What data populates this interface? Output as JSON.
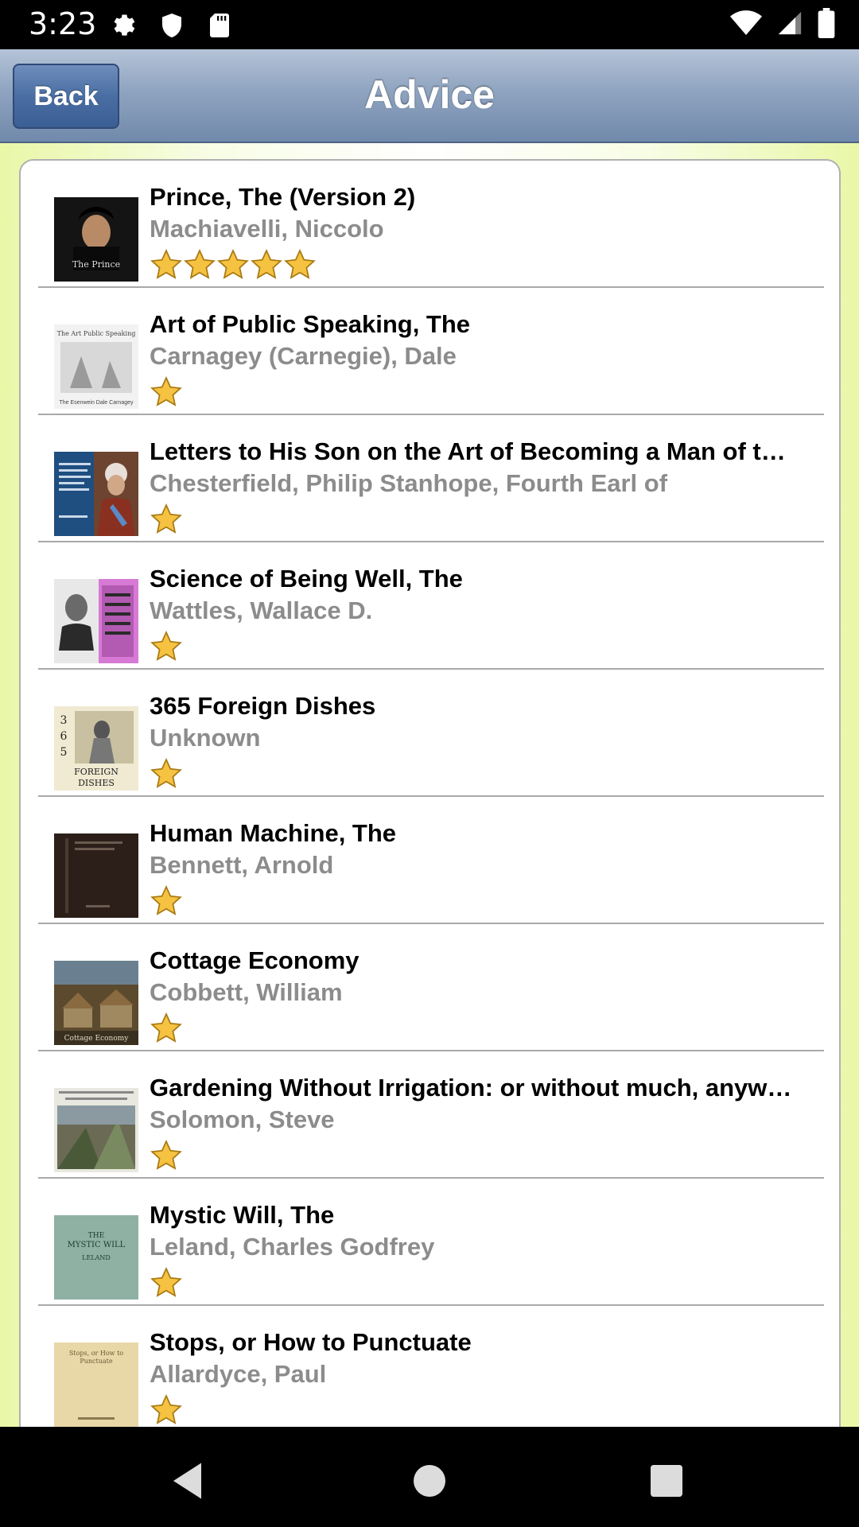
{
  "status_bar": {
    "time": "3:23",
    "icons": [
      "gear-icon",
      "shield-icon",
      "sd-card-icon",
      "wifi-icon",
      "signal-icon",
      "battery-icon"
    ]
  },
  "header": {
    "back_label": "Back",
    "title": "Advice"
  },
  "books": [
    {
      "title": "Prince, The (Version 2)",
      "author": "Machiavelli, Niccolo",
      "stars": 5,
      "cover": {
        "bg": "#1a1a1a",
        "text": "The Prince"
      }
    },
    {
      "title": "Art of Public Speaking, The",
      "author": "Carnagey (Carnegie), Dale",
      "stars": 1,
      "cover": {
        "bg": "#f2f2f2",
        "text": ""
      }
    },
    {
      "title": "Letters to His Son on the Art of Becoming a Man of t…",
      "author": "Chesterfield, Philip Stanhope, Fourth Earl of",
      "stars": 1,
      "cover": {
        "bg": "#1f4e80",
        "text": ""
      }
    },
    {
      "title": "Science of Being Well, The",
      "author": "Wattles, Wallace D.",
      "stars": 1,
      "cover": {
        "bg": "#d67ad6",
        "text": ""
      }
    },
    {
      "title": "365 Foreign Dishes",
      "author": "Unknown",
      "stars": 1,
      "cover": {
        "bg": "#f0ead2",
        "text": ""
      }
    },
    {
      "title": "Human Machine, The",
      "author": "Bennett, Arnold",
      "stars": 1,
      "cover": {
        "bg": "#2c1f1a",
        "text": ""
      }
    },
    {
      "title": "Cottage Economy",
      "author": "Cobbett, William",
      "stars": 1,
      "cover": {
        "bg": "#5b4a2e",
        "text": ""
      }
    },
    {
      "title": "Gardening Without Irrigation: or without much, anyw…",
      "author": "Solomon, Steve",
      "stars": 1,
      "cover": {
        "bg": "#6b6a55",
        "text": ""
      }
    },
    {
      "title": "Mystic Will, The",
      "author": "Leland, Charles Godfrey",
      "stars": 1,
      "cover": {
        "bg": "#8fb1a3",
        "text": ""
      }
    },
    {
      "title": "Stops, or How to Punctuate",
      "author": "Allardyce, Paul",
      "stars": 1,
      "cover": {
        "bg": "#e8d8a8",
        "text": ""
      }
    }
  ],
  "nav_bar": {
    "icons": [
      "back-triangle-icon",
      "home-circle-icon",
      "recents-square-icon"
    ]
  },
  "colors": {
    "header_top": "#b5c4d8",
    "header_bottom": "#7189ab",
    "back_button": "#4a6ea3",
    "author_gray": "#8c8c8c",
    "star_gold": "#f5c242"
  }
}
